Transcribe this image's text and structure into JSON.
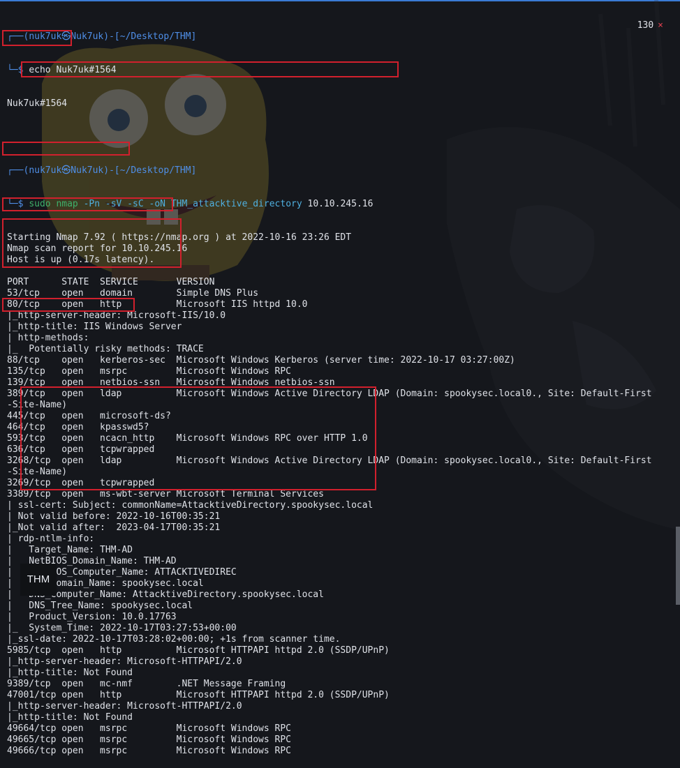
{
  "prompt1": {
    "user": "nuk7uk",
    "at": "㉿",
    "host": "Nuk7uk",
    "path": "~/Desktop/THM"
  },
  "echo_cmd": "echo Nuk7uk#1564",
  "echo_out": "Nuk7uk#1564",
  "exit_code": "130",
  "exit_icon": "×",
  "prompt2": {
    "user": "nuk7uk",
    "at": "㉿",
    "host": "Nuk7uk",
    "path": "~/Desktop/THM"
  },
  "nmap_cmd": {
    "sudo": "sudo",
    "nmap": "nmap",
    "flags": "-Pn -sV -sC -oN",
    "file": "THM_attacktive_directory",
    "ip": "10.10.245.16"
  },
  "output_lines": [
    "Starting Nmap 7.92 ( https://nmap.org ) at 2022-10-16 23:26 EDT",
    "Nmap scan report for 10.10.245.16",
    "Host is up (0.17s latency).",
    "",
    "PORT      STATE  SERVICE       VERSION",
    "53/tcp    open   domain        Simple DNS Plus",
    "80/tcp    open   http          Microsoft IIS httpd 10.0",
    "|_http-server-header: Microsoft-IIS/10.0",
    "|_http-title: IIS Windows Server",
    "| http-methods:",
    "|_  Potentially risky methods: TRACE",
    "88/tcp    open   kerberos-sec  Microsoft Windows Kerberos (server time: 2022-10-17 03:27:00Z)",
    "135/tcp   open   msrpc         Microsoft Windows RPC",
    "139/tcp   open   netbios-ssn   Microsoft Windows netbios-ssn",
    "389/tcp   open   ldap          Microsoft Windows Active Directory LDAP (Domain: spookysec.local0., Site: Default-First",
    "-Site-Name)",
    "445/tcp   open   microsoft-ds?",
    "464/tcp   open   kpasswd5?",
    "593/tcp   open   ncacn_http    Microsoft Windows RPC over HTTP 1.0",
    "636/tcp   open   tcpwrapped",
    "3268/tcp  open   ldap          Microsoft Windows Active Directory LDAP (Domain: spookysec.local0., Site: Default-First",
    "-Site-Name)",
    "3269/tcp  open   tcpwrapped",
    "3389/tcp  open   ms-wbt-server Microsoft Terminal Services",
    "| ssl-cert: Subject: commonName=AttacktiveDirectory.spookysec.local",
    "| Not valid before: 2022-10-16T00:35:21",
    "|_Not valid after:  2023-04-17T00:35:21",
    "| rdp-ntlm-info:",
    "|   Target_Name: THM-AD",
    "|   NetBIOS_Domain_Name: THM-AD",
    "|   NetBIOS_Computer_Name: ATTACKTIVEDIREC",
    "|   DNS_Domain_Name: spookysec.local",
    "|   DNS_Computer_Name: AttacktiveDirectory.spookysec.local",
    "|   DNS_Tree_Name: spookysec.local",
    "|   Product_Version: 10.0.17763",
    "|_  System_Time: 2022-10-17T03:27:53+00:00",
    "|_ssl-date: 2022-10-17T03:28:02+00:00; +1s from scanner time.",
    "5985/tcp  open   http          Microsoft HTTPAPI httpd 2.0 (SSDP/UPnP)",
    "|_http-server-header: Microsoft-HTTPAPI/2.0",
    "|_http-title: Not Found",
    "9389/tcp  open   mc-nmf        .NET Message Framing",
    "47001/tcp open   http          Microsoft HTTPAPI httpd 2.0 (SSDP/UPnP)",
    "|_http-server-header: Microsoft-HTTPAPI/2.0",
    "|_http-title: Not Found",
    "49664/tcp open   msrpc         Microsoft Windows RPC",
    "49665/tcp open   msrpc         Microsoft Windows RPC",
    "49666/tcp open   msrpc         Microsoft Windows RPC"
  ],
  "thm_badge": "THM",
  "colors": {
    "prompt": "#4f8fe8",
    "highlight": "#d1202d",
    "background": "#15171c",
    "text": "#dfe2e8"
  }
}
